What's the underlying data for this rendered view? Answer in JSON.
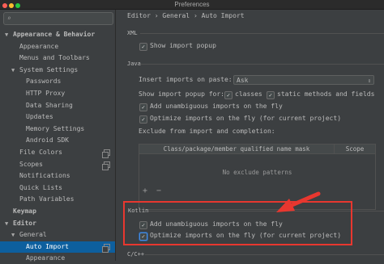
{
  "window": {
    "title": "Preferences"
  },
  "sidebar": {
    "items": [
      {
        "label": "Appearance & Behavior",
        "level": 0,
        "expanded": true,
        "bold": true
      },
      {
        "label": "Appearance",
        "level": 1
      },
      {
        "label": "Menus and Toolbars",
        "level": 1
      },
      {
        "label": "System Settings",
        "level": 1,
        "expanded": true
      },
      {
        "label": "Passwords",
        "level": 2
      },
      {
        "label": "HTTP Proxy",
        "level": 2
      },
      {
        "label": "Data Sharing",
        "level": 2
      },
      {
        "label": "Updates",
        "level": 2
      },
      {
        "label": "Memory Settings",
        "level": 2
      },
      {
        "label": "Android SDK",
        "level": 2
      },
      {
        "label": "File Colors",
        "level": 1,
        "copy_icon": true
      },
      {
        "label": "Scopes",
        "level": 1,
        "copy_icon": true
      },
      {
        "label": "Notifications",
        "level": 1
      },
      {
        "label": "Quick Lists",
        "level": 1
      },
      {
        "label": "Path Variables",
        "level": 1
      },
      {
        "label": "Keymap",
        "level": 0,
        "bold": true
      },
      {
        "label": "Editor",
        "level": 0,
        "expanded": true,
        "bold": true
      },
      {
        "label": "General",
        "level": 1,
        "expanded": true
      },
      {
        "label": "Auto Import",
        "level": 2,
        "selected": true,
        "copy_icon": true
      },
      {
        "label": "Appearance",
        "level": 2
      }
    ]
  },
  "breadcrumb": {
    "part1": "Editor",
    "sep": "›",
    "part2": "General",
    "part3": "Auto Import"
  },
  "xml": {
    "section": "XML",
    "show_import_popup": {
      "label": "Show import popup",
      "checked": true
    }
  },
  "java": {
    "section": "Java",
    "insert_imports_label": "Insert imports on paste:",
    "insert_imports_value": "Ask",
    "show_popup_for_label": "Show import popup for:",
    "classes": {
      "label": "classes",
      "checked": true
    },
    "static_methods": {
      "label": "static methods and fields",
      "checked": true
    },
    "add_unambiguous": {
      "label": "Add unambiguous imports on the fly",
      "checked": true
    },
    "optimize": {
      "label": "Optimize imports on the fly (for current project)",
      "checked": true
    },
    "exclude_label": "Exclude from import and completion:",
    "table": {
      "headers": [
        "Class/package/member qualified name mask",
        "Scope"
      ],
      "empty_text": "No exclude patterns"
    },
    "add_button": "+",
    "remove_button": "−"
  },
  "kotlin": {
    "section": "Kotlin",
    "add_unambiguous": {
      "label": "Add unambiguous imports on the fly",
      "checked": true
    },
    "optimize": {
      "label": "Optimize imports on the fly (for current project)",
      "checked": true
    }
  },
  "cpp": {
    "section": "C/C++"
  },
  "glyphs": {
    "check": "✓",
    "arrow_down": "▼",
    "arrow_right": "▶",
    "select_arrow": "⇕",
    "search": "⌕"
  },
  "colors": {
    "selection": "#0d5f9e",
    "annotation": "#e8372f",
    "background": "#3c3f41"
  }
}
